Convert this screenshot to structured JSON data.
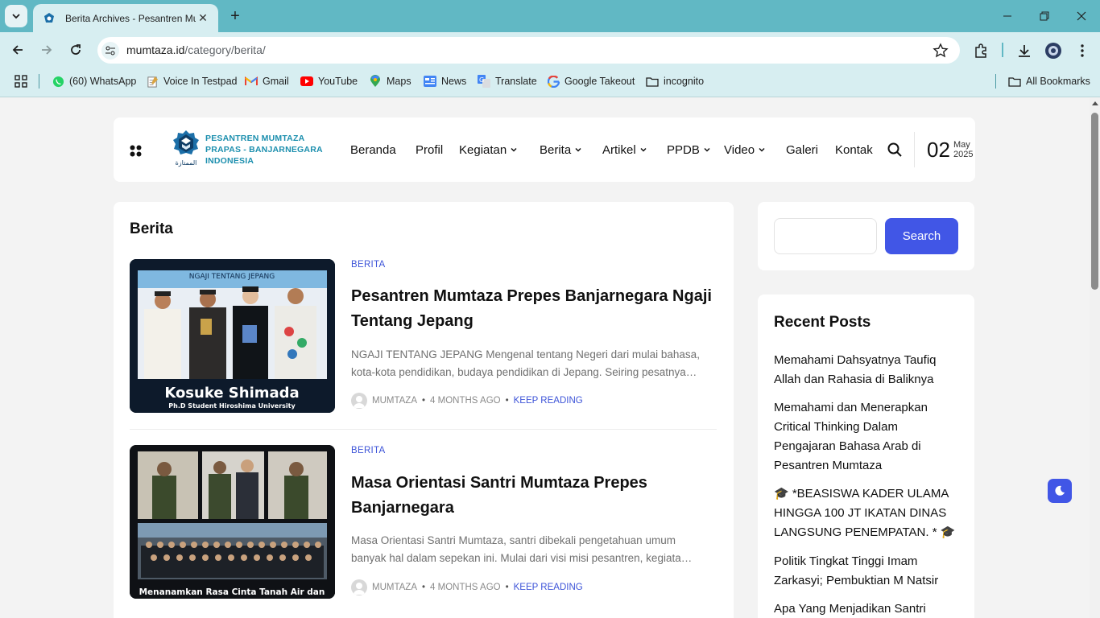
{
  "browser": {
    "tab_title": "Berita Archives - Pesantren Mumtaza",
    "url_domain": "mumtaza.id",
    "url_path": "/category/berita/",
    "bookmarks": [
      {
        "label": "(60) WhatsApp",
        "icon": "whatsapp-icon"
      },
      {
        "label": "Voice In Testpad",
        "icon": "notepad-icon"
      },
      {
        "label": "Gmail",
        "icon": "gmail-icon"
      },
      {
        "label": "YouTube",
        "icon": "youtube-icon"
      },
      {
        "label": "Maps",
        "icon": "maps-icon"
      },
      {
        "label": "News",
        "icon": "news-icon"
      },
      {
        "label": "Translate",
        "icon": "translate-icon"
      },
      {
        "label": "Google Takeout",
        "icon": "google-icon"
      },
      {
        "label": "incognito",
        "icon": "folder-icon"
      }
    ],
    "all_bookmarks": "All Bookmarks"
  },
  "site": {
    "logo_lines": [
      "PESANTREN MUMTAZA",
      "PRAPAS - BANJARNEGARA",
      "INDONESIA"
    ],
    "logo_caption": "الممتازة",
    "menu": [
      {
        "label": "Beranda",
        "dropdown": false
      },
      {
        "label": "Profil",
        "dropdown": false
      },
      {
        "label": "Kegiatan",
        "dropdown": true
      },
      {
        "label": "Berita",
        "dropdown": true
      },
      {
        "label": "Artikel",
        "dropdown": true
      },
      {
        "label": "PPDB",
        "dropdown": true
      },
      {
        "label": "Video",
        "dropdown": true
      },
      {
        "label": "Galeri",
        "dropdown": false
      },
      {
        "label": "Kontak",
        "dropdown": false
      }
    ],
    "date_day": "02",
    "date_month": "May",
    "date_year": "2025"
  },
  "main": {
    "page_title": "Berita",
    "posts": [
      {
        "category": "BERITA",
        "title_lines": [
          "Pesantren Mumtaza Prepes Banjarnegara Ngaji",
          "Tentang Jepang"
        ],
        "excerpt_lines": [
          "NGAJI TENTANG JEPANG Mengenal tentang Negeri dari mulai bahasa,",
          "kota-kota pendidikan, budaya pendidikan di Jepang. Seiring pesatnya…"
        ],
        "author": "MUMTAZA",
        "time": "4 MONTHS AGO",
        "link": "KEEP READING",
        "thumb_caption": "Kosuke Shimada",
        "thumb_subcaption": "Ph.D Student Hiroshima University",
        "thumb_banner": "NGAJI TENTANG JEPANG"
      },
      {
        "category": "BERITA",
        "title_lines": [
          "Masa Orientasi Santri Mumtaza Prepes",
          "Banjarnegara"
        ],
        "excerpt_lines": [
          "Masa Orientasi Santri Mumtaza, santri dibekali pengetahuan umum",
          "banyak hal dalam sepekan ini. Mulai dari visi misi pesantren, kegiata…"
        ],
        "author": "MUMTAZA",
        "time": "4 MONTHS AGO",
        "link": "KEEP READING",
        "thumb_caption": "Menanamkan Rasa Cinta Tanah Air dan"
      }
    ]
  },
  "sidebar": {
    "search_button": "Search",
    "search_value": "",
    "recent_title": "Recent Posts",
    "recent_posts": [
      [
        "Memahami Dahsyatnya Taufiq",
        "Allah dan Rahasia di Baliknya"
      ],
      [
        "Memahami dan Menerapkan",
        "Critical Thinking Dalam",
        "Pengajaran Bahasa Arab di",
        "Pesantren Mumtaza"
      ],
      [
        "🎓 *BEASISWA KADER ULAMA",
        "HINGGA 100 JT IKATAN DINAS",
        "LANGSUNG PENEMPATAN. * 🎓"
      ],
      [
        "Politik Tingkat Tinggi Imam",
        "Zarkasyi; Pembuktian M Natsir"
      ],
      [
        "Apa Yang Menjadikan Santri"
      ]
    ]
  },
  "colors": {
    "chrome_teal": "#61b8c4",
    "chrome_light": "#d7eef1",
    "accent_blue": "#4156e6",
    "logo_blue": "#1c8fae"
  }
}
